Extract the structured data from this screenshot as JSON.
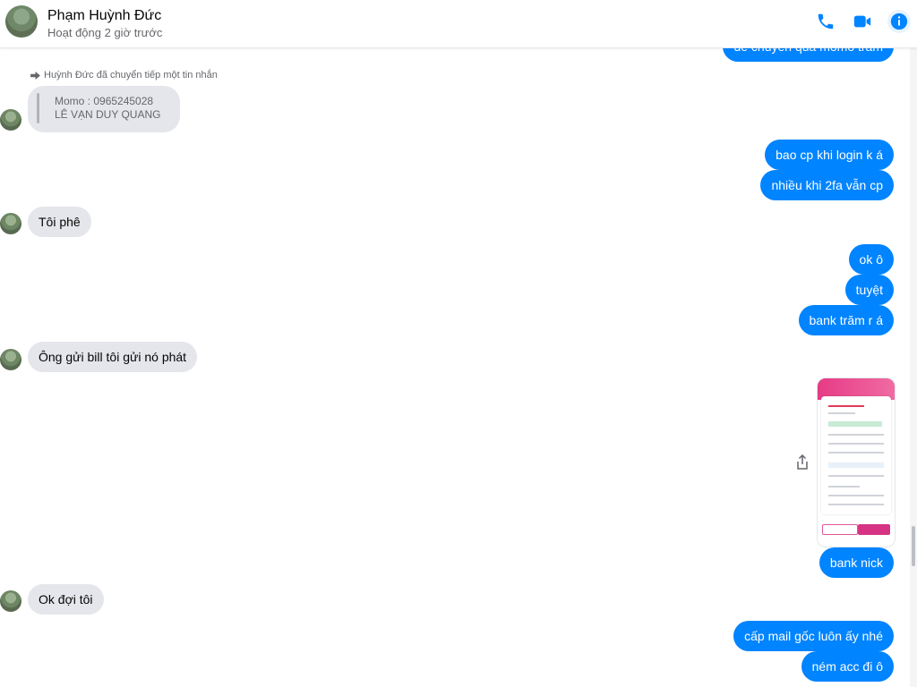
{
  "header": {
    "name": "Phạm Huỳnh Đức",
    "status": "Hoạt động 2 giờ trước",
    "accent_color": "#0084ff",
    "icons": [
      "phone-icon",
      "video-camera-icon",
      "info-icon"
    ]
  },
  "forward": {
    "note": "Huỳnh Đức đã chuyển tiếp một tin nhắn",
    "line1": "Momo : 0965245028",
    "line2": "LÊ VẠN DUY QUANG"
  },
  "messages": {
    "m0": "để chuyển qua momo trăm",
    "m1": "bao cp khi login k á",
    "m2": "nhiều khi 2fa vẫn cp",
    "m3": "Tôi phê",
    "m4": "ok ô",
    "m5": "tuyệt",
    "m6": "bank trăm r á",
    "m7": "Ông gửi bill tôi gửi nó phát",
    "m8": "bank nick",
    "m9": "Ok đợi tôi",
    "m10": "cấp mail gốc luôn ấy nhé",
    "m11": "ném acc đi ô"
  }
}
